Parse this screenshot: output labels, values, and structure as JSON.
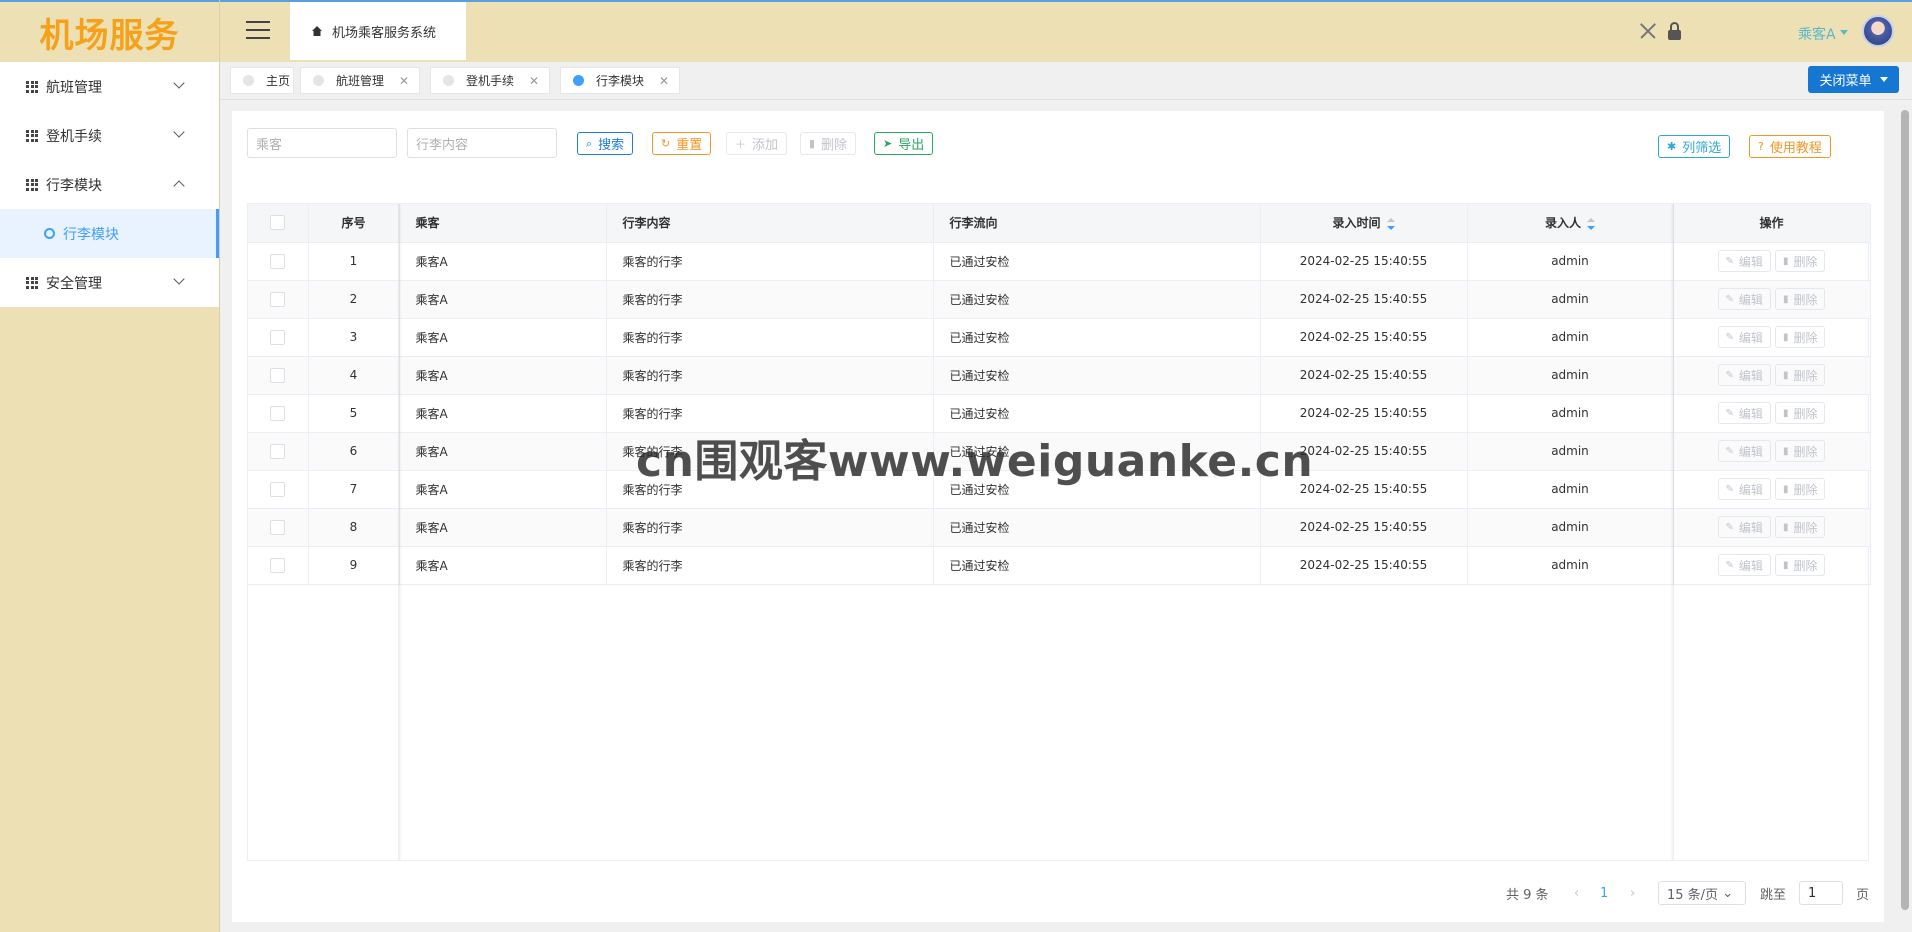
{
  "brand": {
    "logo": "机场服务"
  },
  "sidebar": {
    "items": [
      {
        "label": "航班管理",
        "expanded": false
      },
      {
        "label": "登机手续",
        "expanded": false
      },
      {
        "label": "行李模块",
        "expanded": true,
        "children": [
          {
            "label": "行李模块",
            "active": true
          }
        ]
      },
      {
        "label": "安全管理",
        "expanded": false
      }
    ]
  },
  "header": {
    "home_label": "机场乘客服务系统",
    "user_name": "乘客A",
    "icons": [
      "fullscreen-icon",
      "lock-icon"
    ]
  },
  "tabs": [
    {
      "label": "主页",
      "closable": false,
      "active": false
    },
    {
      "label": "航班管理",
      "closable": true,
      "active": false
    },
    {
      "label": "登机手续",
      "closable": true,
      "active": false
    },
    {
      "label": "行李模块",
      "closable": true,
      "active": true
    }
  ],
  "close_menu_label": "关闭菜单",
  "toolbar": {
    "passenger_placeholder": "乘客",
    "content_placeholder": "行李内容",
    "search": "搜索",
    "reset": "重置",
    "add": "添加",
    "delete": "删除",
    "export": "导出",
    "column_filter": "列筛选",
    "tutorial": "使用教程"
  },
  "table": {
    "columns": [
      "序号",
      "乘客",
      "行李内容",
      "行李流向",
      "录入时间",
      "录入人",
      "操作"
    ],
    "actions": {
      "edit": "编辑",
      "delete": "删除"
    },
    "rows": [
      {
        "no": "1",
        "passenger": "乘客A",
        "content": "乘客的行李",
        "flow": "已通过安检",
        "time": "2024-02-25 15:40:55",
        "operator": "admin"
      },
      {
        "no": "2",
        "passenger": "乘客A",
        "content": "乘客的行李",
        "flow": "已通过安检",
        "time": "2024-02-25 15:40:55",
        "operator": "admin"
      },
      {
        "no": "3",
        "passenger": "乘客A",
        "content": "乘客的行李",
        "flow": "已通过安检",
        "time": "2024-02-25 15:40:55",
        "operator": "admin"
      },
      {
        "no": "4",
        "passenger": "乘客A",
        "content": "乘客的行李",
        "flow": "已通过安检",
        "time": "2024-02-25 15:40:55",
        "operator": "admin"
      },
      {
        "no": "5",
        "passenger": "乘客A",
        "content": "乘客的行李",
        "flow": "已通过安检",
        "time": "2024-02-25 15:40:55",
        "operator": "admin"
      },
      {
        "no": "6",
        "passenger": "乘客A",
        "content": "乘客的行李",
        "flow": "已通过安检",
        "time": "2024-02-25 15:40:55",
        "operator": "admin"
      },
      {
        "no": "7",
        "passenger": "乘客A",
        "content": "乘客的行李",
        "flow": "已通过安检",
        "time": "2024-02-25 15:40:55",
        "operator": "admin"
      },
      {
        "no": "8",
        "passenger": "乘客A",
        "content": "乘客的行李",
        "flow": "已通过安检",
        "time": "2024-02-25 15:40:55",
        "operator": "admin"
      },
      {
        "no": "9",
        "passenger": "乘客A",
        "content": "乘客的行李",
        "flow": "已通过安检",
        "time": "2024-02-25 15:40:55",
        "operator": "admin"
      }
    ]
  },
  "pagination": {
    "total": "共 9 条",
    "current_page": "1",
    "page_size": "15 条/页",
    "jump_label": "跳至",
    "jump_value": "1",
    "page_unit": "页"
  },
  "watermark": "cn围观客www.weiguanke.cn",
  "colors": {
    "sidebar_bg": "#ece0b4",
    "accent": "#409eff",
    "logo": "#f5a21a",
    "primary_button": "#1677d2"
  }
}
